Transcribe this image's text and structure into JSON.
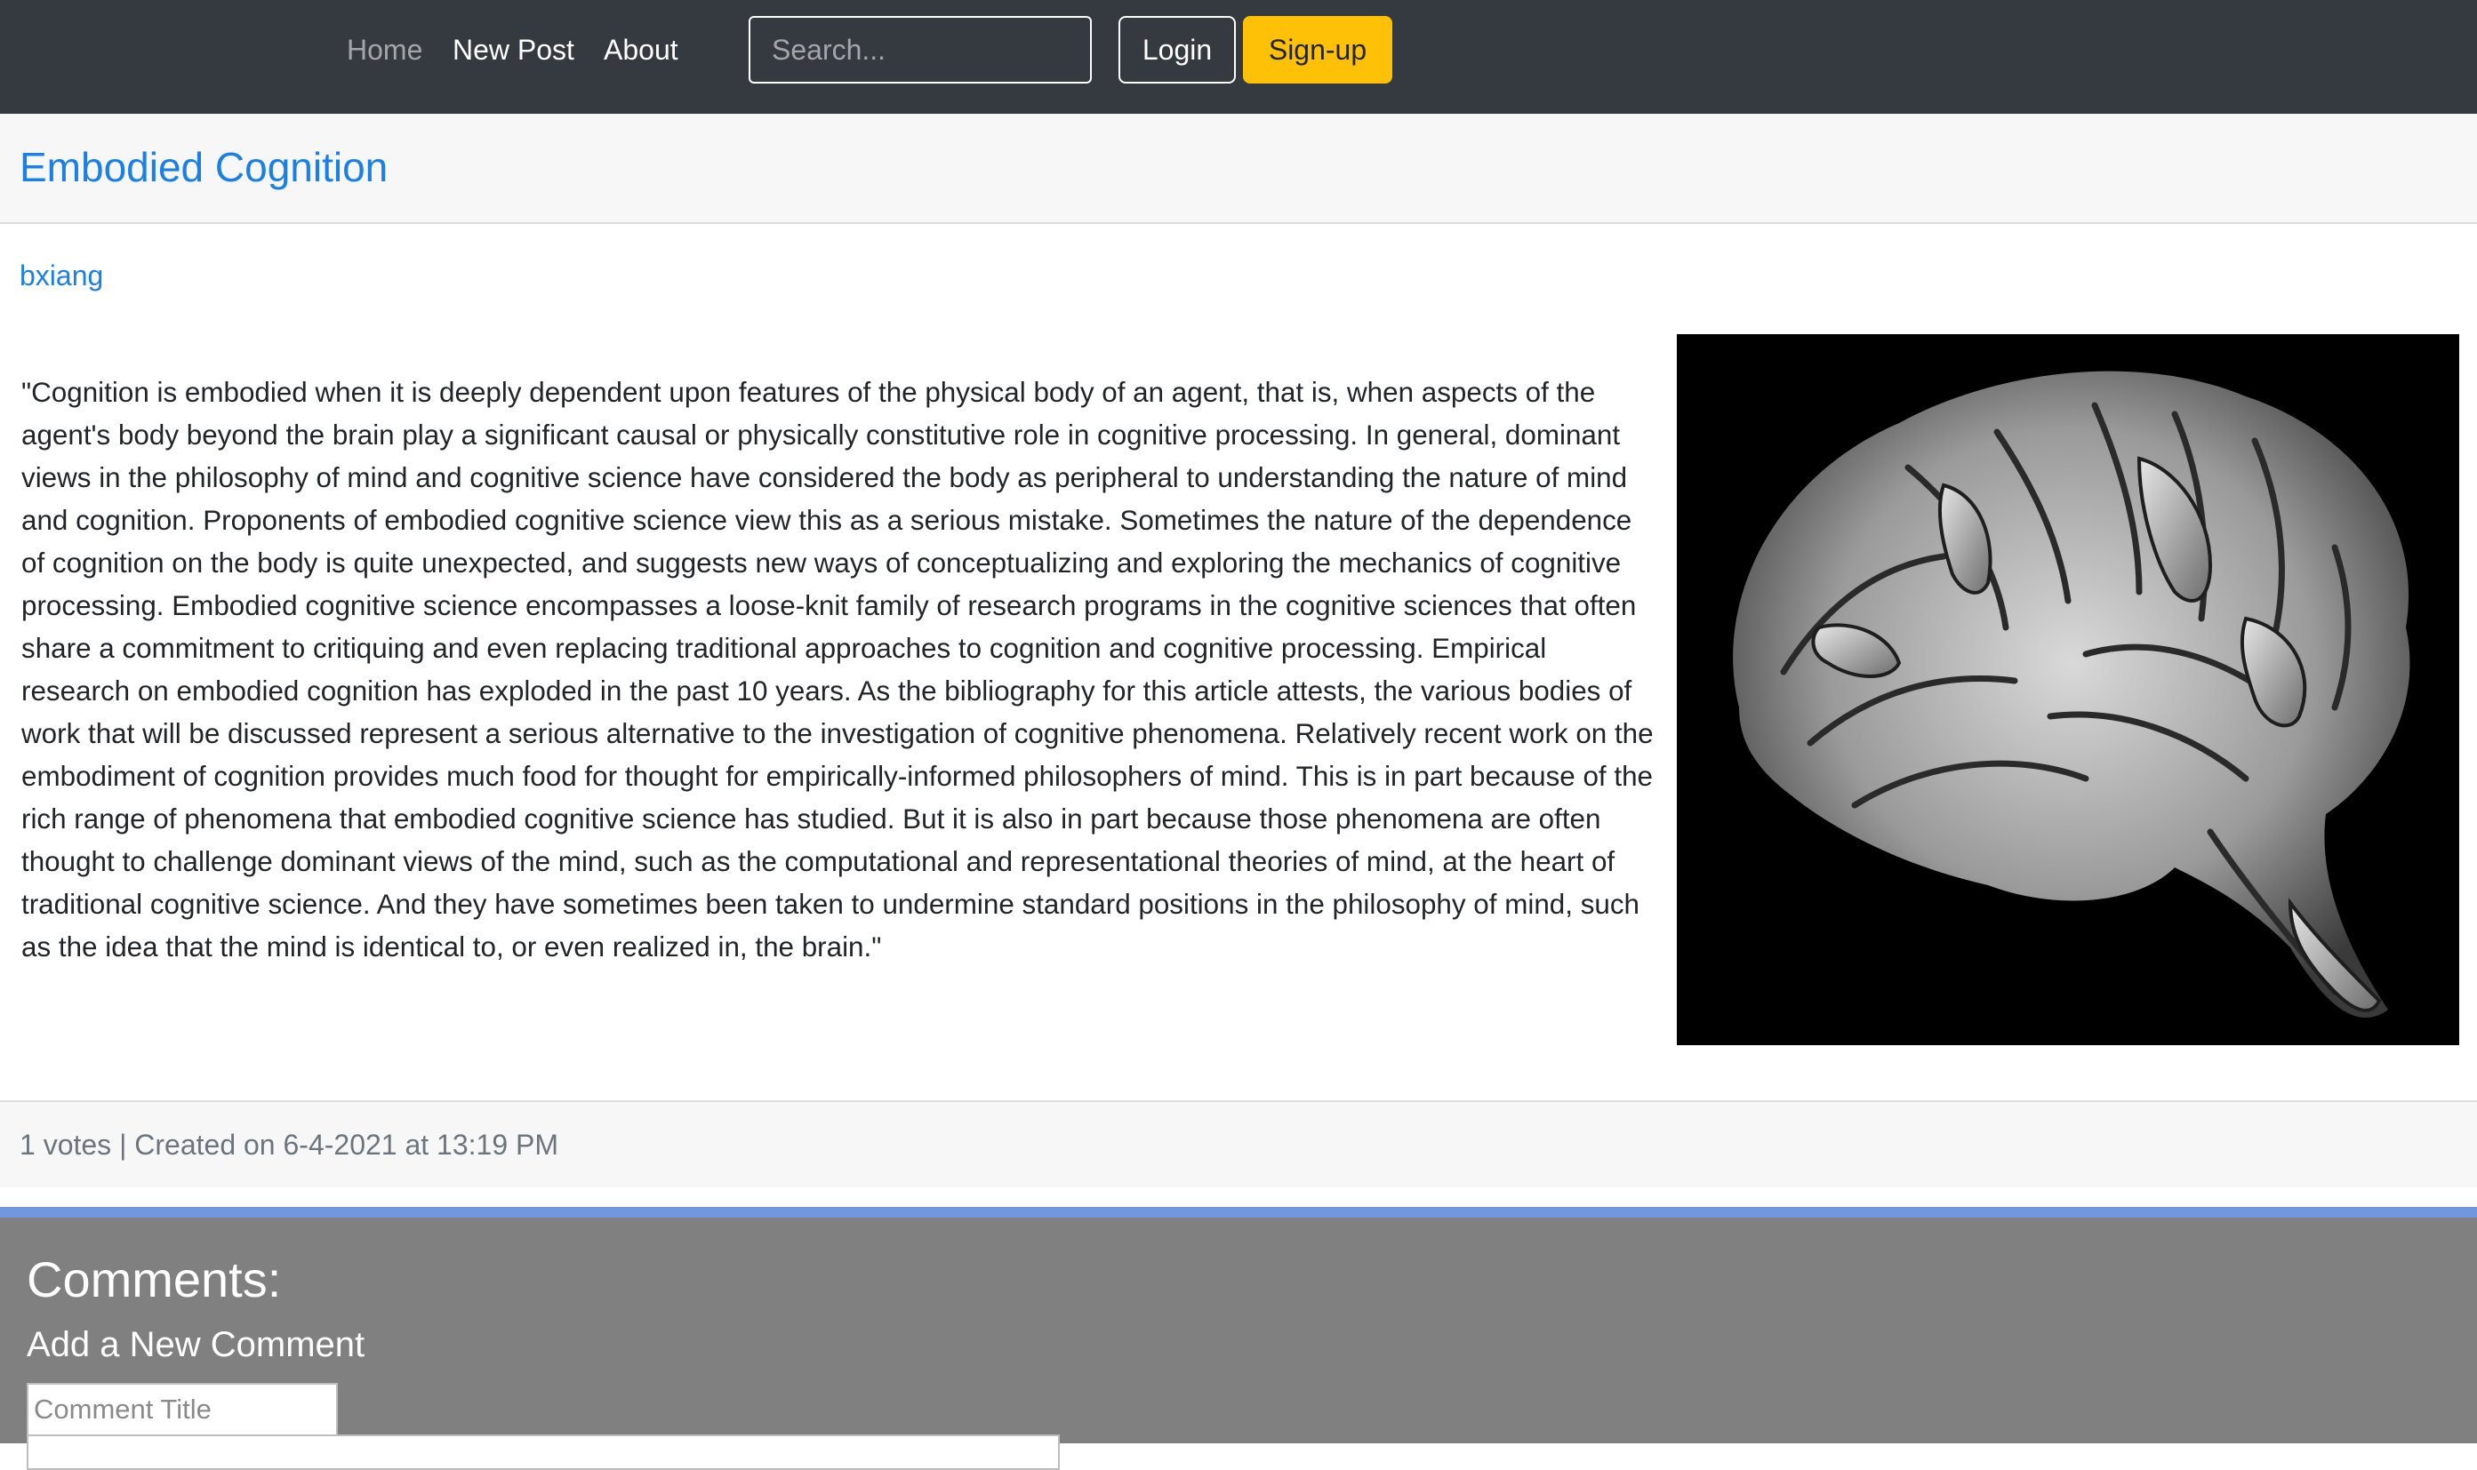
{
  "nav": {
    "home_label": "Home",
    "new_post_label": "New Post",
    "about_label": "About",
    "search_placeholder": "Search...",
    "login_label": "Login",
    "signup_label": "Sign-up"
  },
  "post": {
    "title": "Embodied Cognition",
    "author": "bxiang",
    "body": "\"Cognition is embodied when it is deeply dependent upon features of the physical body of an agent, that is, when aspects of the agent's body beyond the brain play a significant causal or physically constitutive role in cognitive processing. In general, dominant views in the philosophy of mind and cognitive science have considered the body as peripheral to understanding the nature of mind and cognition. Proponents of embodied cognitive science view this as a serious mistake. Sometimes the nature of the dependence of cognition on the body is quite unexpected, and suggests new ways of conceptualizing and exploring the mechanics of cognitive processing. Embodied cognitive science encompasses a loose-knit family of research programs in the cognitive sciences that often share a commitment to critiquing and even replacing traditional approaches to cognition and cognitive processing. Empirical research on embodied cognition has exploded in the past 10 years. As the bibliography for this article attests, the various bodies of work that will be discussed represent a serious alternative to the investigation of cognitive phenomena. Relatively recent work on the embodiment of cognition provides much food for thought for empirically-informed philosophers of mind. This is in part because of the rich range of phenomena that embodied cognitive science has studied. But it is also in part because those phenomena are often thought to challenge dominant views of the mind, such as the computational and representational theories of mind, at the heart of traditional cognitive science. And they have sometimes been taken to undermine standard positions in the philosophy of mind, such as the idea that the mind is identical to, or even realized in, the brain.\"",
    "footer": "1 votes | Created on 6-4-2021 at 13:19 PM"
  },
  "comments": {
    "heading": "Comments:",
    "add_heading": "Add a New Comment",
    "title_placeholder": "Comment Title"
  },
  "colors": {
    "navbar": "#343a40",
    "link": "#1a7fe6",
    "signup": "#ffc107",
    "comments_bg": "#808080",
    "comments_accent": "#7096e0"
  }
}
